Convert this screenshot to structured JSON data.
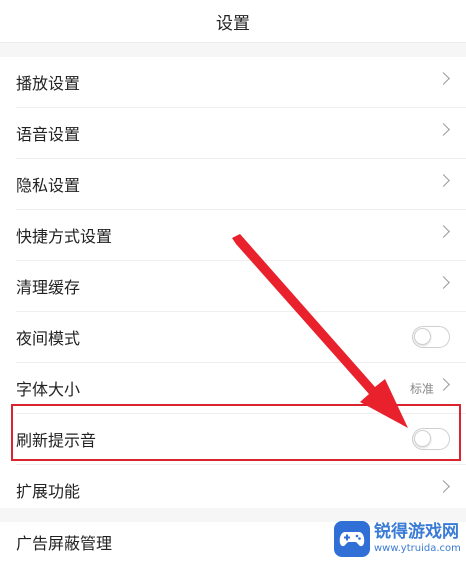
{
  "header": {
    "title": "设置"
  },
  "settings": {
    "items": [
      {
        "label": "播放设置"
      },
      {
        "label": "语音设置"
      },
      {
        "label": "隐私设置"
      },
      {
        "label": "快捷方式设置"
      },
      {
        "label": "清理缓存"
      },
      {
        "label": "夜间模式",
        "toggle_on": false
      },
      {
        "label": "字体大小",
        "value": "标准"
      },
      {
        "label": "刷新提示音",
        "toggle_on": false
      },
      {
        "label": "扩展功能"
      }
    ],
    "last_item": {
      "label": "广告屏蔽管理"
    }
  },
  "annotation": {
    "highlight_color": "#d9232d",
    "arrow_color": "#e8212c"
  },
  "watermark": {
    "main": "锐得游戏网",
    "url": "www.ytruida.com"
  },
  "colors": {
    "background": "#ffffff",
    "divider": "#eeeeee",
    "section_bg": "#f6f6f6"
  }
}
